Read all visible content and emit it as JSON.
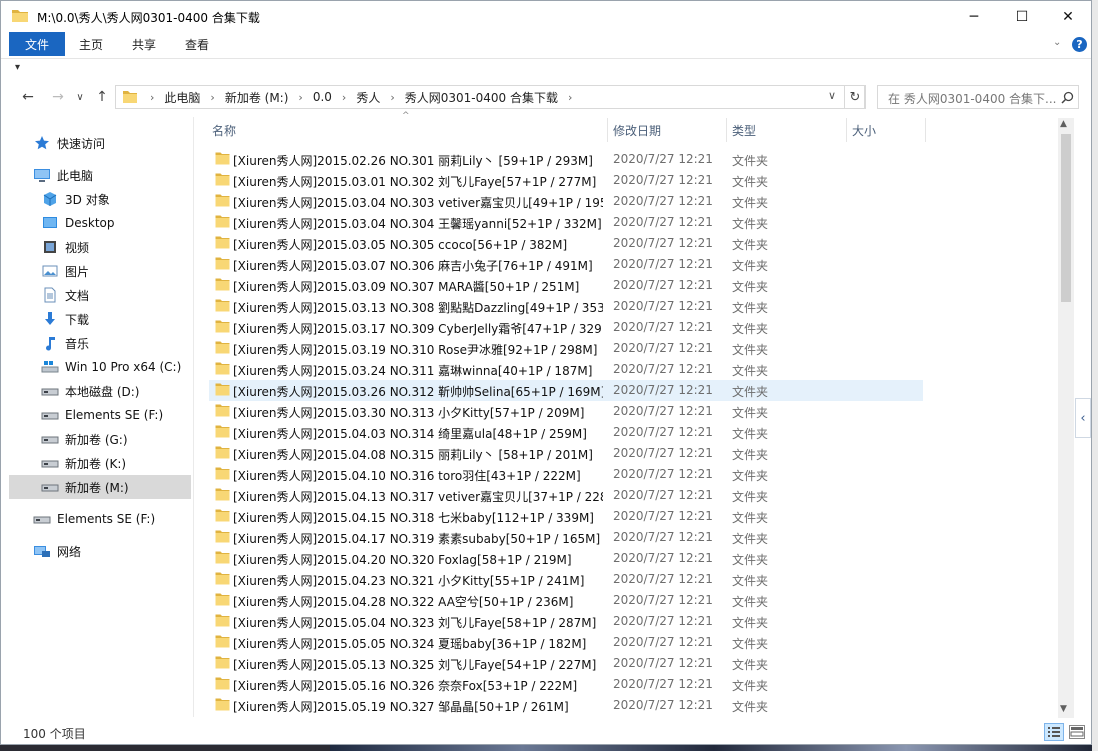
{
  "window": {
    "title": "M:\\0.0\\秀人\\秀人网0301-0400 合集下载",
    "minimize": "─",
    "maximize": "☐",
    "close": "✕"
  },
  "ribbon": {
    "tabs": [
      "文件",
      "主页",
      "共享",
      "查看"
    ],
    "help": "?",
    "expand_chevron": "⌄"
  },
  "qat": {
    "dropdown": "▾"
  },
  "address": {
    "breadcrumbs": [
      "此电脑",
      "新加卷 (M:)",
      "0.0",
      "秀人",
      "秀人网0301-0400 合集下载"
    ],
    "separator": "›",
    "dropdown": "∨",
    "refresh": "↻"
  },
  "search": {
    "placeholder": "在 秀人网0301-0400 合集下..."
  },
  "nav": {
    "back": "←",
    "forward": "→",
    "recent": "∨",
    "up": "↑"
  },
  "sidebar": {
    "items": [
      {
        "label": "快速访问",
        "icon": "star-icon",
        "indent": 0
      },
      {
        "label": "此电脑",
        "icon": "computer-icon",
        "indent": 0
      },
      {
        "label": "3D 对象",
        "icon": "cube-icon",
        "indent": 1
      },
      {
        "label": "Desktop",
        "icon": "desktop-icon",
        "indent": 1
      },
      {
        "label": "视频",
        "icon": "video-icon",
        "indent": 1
      },
      {
        "label": "图片",
        "icon": "picture-icon",
        "indent": 1
      },
      {
        "label": "文档",
        "icon": "document-icon",
        "indent": 1
      },
      {
        "label": "下载",
        "icon": "download-icon",
        "indent": 1
      },
      {
        "label": "音乐",
        "icon": "music-icon",
        "indent": 1
      },
      {
        "label": "Win 10 Pro x64 (C:)",
        "icon": "windows-drive-icon",
        "indent": 1
      },
      {
        "label": "本地磁盘 (D:)",
        "icon": "drive-icon",
        "indent": 1
      },
      {
        "label": "Elements SE (F:)",
        "icon": "drive-icon",
        "indent": 1
      },
      {
        "label": "新加卷 (G:)",
        "icon": "drive-icon",
        "indent": 1
      },
      {
        "label": "新加卷 (K:)",
        "icon": "drive-icon",
        "indent": 1
      },
      {
        "label": "新加卷 (M:)",
        "icon": "drive-icon",
        "indent": 1,
        "selected": true
      },
      {
        "label": "Elements SE (F:)",
        "icon": "drive-icon",
        "indent": 0
      },
      {
        "label": "网络",
        "icon": "network-icon",
        "indent": 0
      }
    ]
  },
  "columns": {
    "name": "名称",
    "modified": "修改日期",
    "type": "类型",
    "size": "大小",
    "sort_arrow": "^"
  },
  "files": [
    {
      "name": "[Xiuren秀人网]2015.02.26 NO.301 丽莉Lily丶 [59+1P / 293M]",
      "modified": "2020/7/27 12:21",
      "type": "文件夹"
    },
    {
      "name": "[Xiuren秀人网]2015.03.01 NO.302 刘飞儿Faye[57+1P / 277M]",
      "modified": "2020/7/27 12:21",
      "type": "文件夹"
    },
    {
      "name": "[Xiuren秀人网]2015.03.04 NO.303 vetiver嘉宝贝儿[49+1P / 195...",
      "modified": "2020/7/27 12:21",
      "type": "文件夹"
    },
    {
      "name": "[Xiuren秀人网]2015.03.04 NO.304 王馨瑶yanni[52+1P / 332M]",
      "modified": "2020/7/27 12:21",
      "type": "文件夹"
    },
    {
      "name": "[Xiuren秀人网]2015.03.05 NO.305 ccoco[56+1P / 382M]",
      "modified": "2020/7/27 12:21",
      "type": "文件夹"
    },
    {
      "name": "[Xiuren秀人网]2015.03.07 NO.306 麻吉小兔子[76+1P / 491M]",
      "modified": "2020/7/27 12:21",
      "type": "文件夹"
    },
    {
      "name": "[Xiuren秀人网]2015.03.09 NO.307 MARA醬[50+1P / 251M]",
      "modified": "2020/7/27 12:21",
      "type": "文件夹"
    },
    {
      "name": "[Xiuren秀人网]2015.03.13 NO.308 劉點點Dazzling[49+1P / 353...",
      "modified": "2020/7/27 12:21",
      "type": "文件夹"
    },
    {
      "name": "[Xiuren秀人网]2015.03.17 NO.309 CyberJelly霜爷[47+1P / 329...",
      "modified": "2020/7/27 12:21",
      "type": "文件夹"
    },
    {
      "name": "[Xiuren秀人网]2015.03.19 NO.310 Rose尹冰雅[92+1P / 298M]",
      "modified": "2020/7/27 12:21",
      "type": "文件夹"
    },
    {
      "name": "[Xiuren秀人网]2015.03.24 NO.311 嘉琳winna[40+1P / 187M]",
      "modified": "2020/7/27 12:21",
      "type": "文件夹"
    },
    {
      "name": "[Xiuren秀人网]2015.03.26 NO.312 靳帅帅Selina[65+1P / 169M]",
      "modified": "2020/7/27 12:21",
      "type": "文件夹",
      "highlighted": true
    },
    {
      "name": "[Xiuren秀人网]2015.03.30 NO.313 小夕Kitty[57+1P / 209M]",
      "modified": "2020/7/27 12:21",
      "type": "文件夹"
    },
    {
      "name": "[Xiuren秀人网]2015.04.03 NO.314 绮里嘉ula[48+1P / 259M]",
      "modified": "2020/7/27 12:21",
      "type": "文件夹"
    },
    {
      "name": "[Xiuren秀人网]2015.04.08 NO.315 丽莉Lily丶 [58+1P / 201M]",
      "modified": "2020/7/27 12:21",
      "type": "文件夹"
    },
    {
      "name": "[Xiuren秀人网]2015.04.10 NO.316 toro羽住[43+1P / 222M]",
      "modified": "2020/7/27 12:21",
      "type": "文件夹"
    },
    {
      "name": "[Xiuren秀人网]2015.04.13 NO.317 vetiver嘉宝贝儿[37+1P / 228...",
      "modified": "2020/7/27 12:21",
      "type": "文件夹"
    },
    {
      "name": "[Xiuren秀人网]2015.04.15 NO.318 七米baby[112+1P / 339M]",
      "modified": "2020/7/27 12:21",
      "type": "文件夹"
    },
    {
      "name": "[Xiuren秀人网]2015.04.17 NO.319 素素subaby[50+1P / 165M]",
      "modified": "2020/7/27 12:21",
      "type": "文件夹"
    },
    {
      "name": "[Xiuren秀人网]2015.04.20 NO.320 Foxlag[58+1P / 219M]",
      "modified": "2020/7/27 12:21",
      "type": "文件夹"
    },
    {
      "name": "[Xiuren秀人网]2015.04.23 NO.321 小夕Kitty[55+1P / 241M]",
      "modified": "2020/7/27 12:21",
      "type": "文件夹"
    },
    {
      "name": "[Xiuren秀人网]2015.04.28 NO.322 AA空兮[50+1P / 236M]",
      "modified": "2020/7/27 12:21",
      "type": "文件夹"
    },
    {
      "name": "[Xiuren秀人网]2015.05.04 NO.323 刘飞儿Faye[58+1P / 287M]",
      "modified": "2020/7/27 12:21",
      "type": "文件夹"
    },
    {
      "name": "[Xiuren秀人网]2015.05.05 NO.324 夏瑶baby[36+1P / 182M]",
      "modified": "2020/7/27 12:21",
      "type": "文件夹"
    },
    {
      "name": "[Xiuren秀人网]2015.05.13 NO.325 刘飞儿Faye[54+1P / 227M]",
      "modified": "2020/7/27 12:21",
      "type": "文件夹"
    },
    {
      "name": "[Xiuren秀人网]2015.05.16 NO.326 奈奈Fox[53+1P / 222M]",
      "modified": "2020/7/27 12:21",
      "type": "文件夹"
    },
    {
      "name": "[Xiuren秀人网]2015.05.19 NO.327 邹晶晶[50+1P / 261M]",
      "modified": "2020/7/27 12:21",
      "type": "文件夹"
    }
  ],
  "scrollbar": {
    "up": "▲",
    "down": "▼",
    "side_tab": "‹"
  },
  "status": {
    "item_count": "100 个项目"
  },
  "colors": {
    "accent": "#1a66c1",
    "folder": "#f8d775",
    "folder_dark": "#e0b340",
    "hover": "#e5f1fb",
    "selected": "#d9d9d9"
  }
}
